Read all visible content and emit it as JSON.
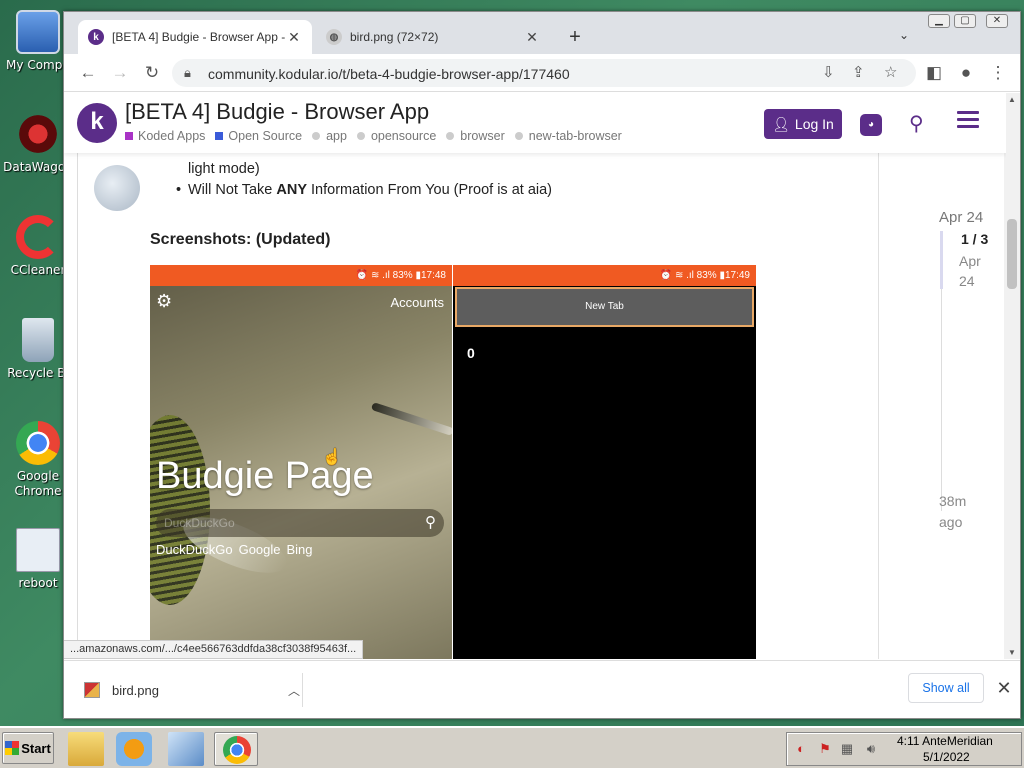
{
  "desktop": {
    "icons": [
      {
        "label": "My Compu"
      },
      {
        "label": "DataWagon"
      },
      {
        "label": "CCleaner"
      },
      {
        "label": "Recycle Bi"
      },
      {
        "label": "Google Chrome"
      },
      {
        "label": "reboot"
      }
    ]
  },
  "browser": {
    "tabs": [
      {
        "title": "[BETA 4] Budgie - Browser App -",
        "active": true
      },
      {
        "title": "bird.png (72×72)",
        "active": false
      }
    ],
    "url": "community.kodular.io/t/beta-4-budgie-browser-app/177460"
  },
  "forum": {
    "logo_letter": "k",
    "topic_title": "[BETA 4] Budgie - Browser App",
    "tags": [
      {
        "label": "Koded Apps",
        "color": "#a933c6",
        "kind": "category"
      },
      {
        "label": "Open Source",
        "color": "#3a5bd9",
        "kind": "category"
      },
      {
        "label": "app",
        "kind": "tag"
      },
      {
        "label": "opensource",
        "kind": "tag"
      },
      {
        "label": "browser",
        "kind": "tag"
      },
      {
        "label": "new-tab-browser",
        "kind": "tag"
      }
    ],
    "login_label": "Log In",
    "accent": "#5b2d89"
  },
  "post": {
    "line_continued": "light mode)",
    "bullet_prefix": "Will Not Take ",
    "bullet_bold": "ANY",
    "bullet_suffix": " Information From You (Proof is at aia)",
    "screenshots_heading": "Screenshots: (Updated)"
  },
  "phone1": {
    "status": "⏰ ≋ .ıl 83% ▮17:48",
    "accounts": "Accounts",
    "title": "Budgie Page",
    "search_placeholder": "DuckDuckGo",
    "engines": [
      "DuckDuckGo",
      "Google",
      "Bing"
    ]
  },
  "phone2": {
    "status": "⏰ ≋ .ıl 83% ▮17:49",
    "tab_label": "New Tab",
    "tab_count": "0"
  },
  "timeline": {
    "start": "Apr 24",
    "position": "1 / 3",
    "position_date": "Apr 24",
    "end": "38m ago"
  },
  "status_url": "...amazonaws.com/.../c4ee566763ddfda38cf3038f95463f...",
  "downloads": {
    "file": "bird.png",
    "show_all": "Show all"
  },
  "taskbar": {
    "start_label": "Start",
    "time": "4:11 AnteMeridian",
    "date": "5/1/2022"
  }
}
